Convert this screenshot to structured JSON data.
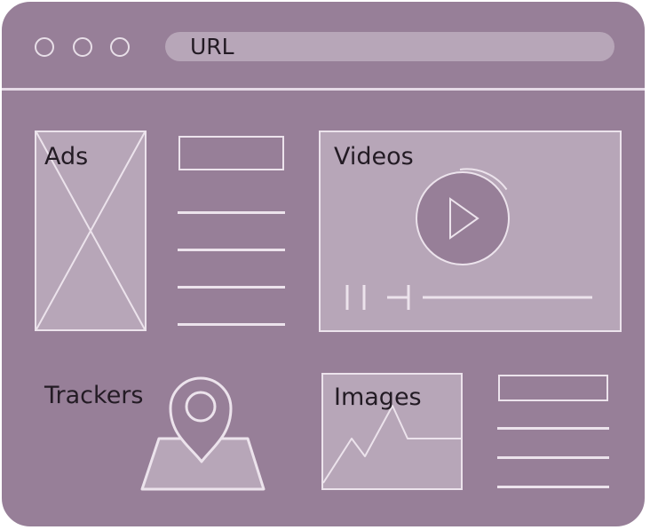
{
  "browser": {
    "url_label": "URL"
  },
  "blocks": {
    "ads_label": "Ads",
    "videos_label": "Videos",
    "trackers_label": "Trackers",
    "images_label": "Images"
  },
  "colors": {
    "background": "#977f98",
    "panel": "#b7a6b8",
    "stroke": "#ece3ec",
    "text": "#231b24"
  }
}
